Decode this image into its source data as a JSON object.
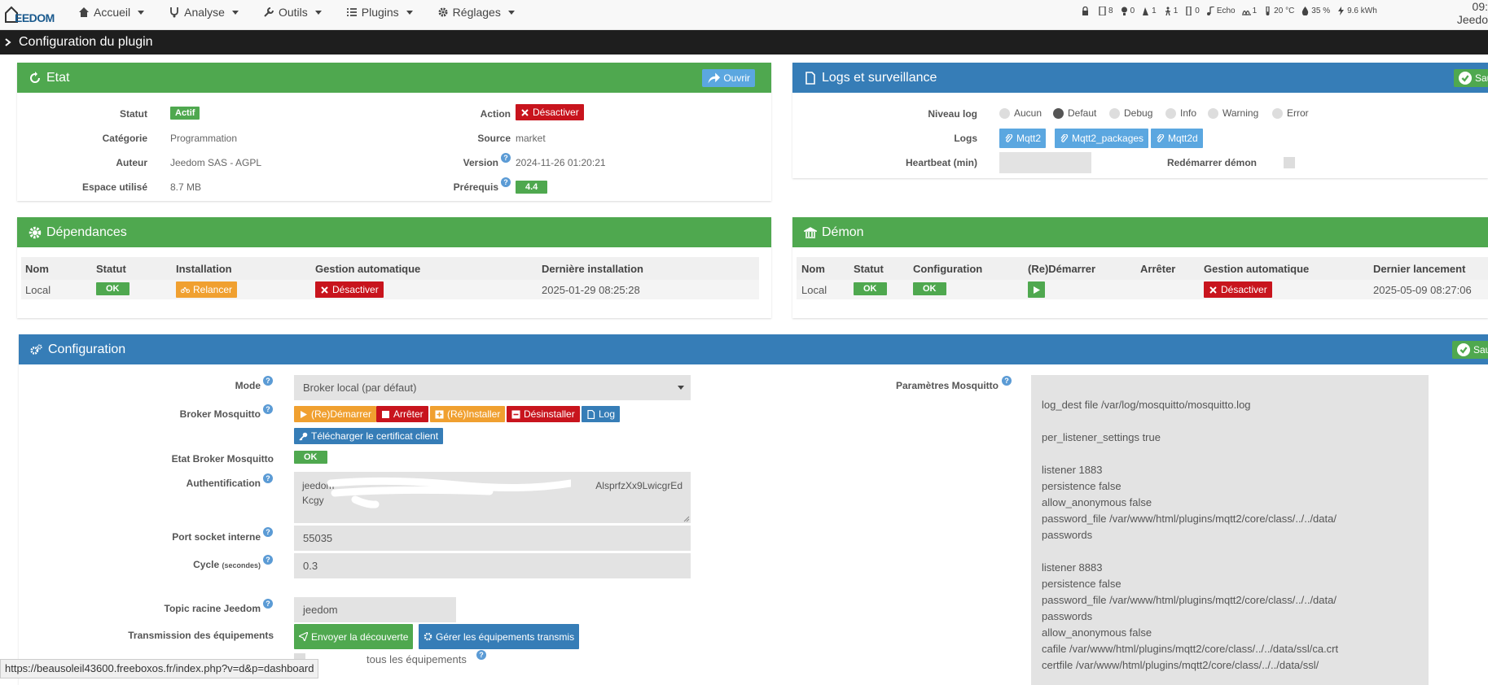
{
  "navbar": {
    "logo_text": "EEDOM",
    "menus": [
      "Accueil",
      "Analyse",
      "Outils",
      "Plugins",
      "Réglages"
    ],
    "summary": [
      {
        "icon": "lock-icon",
        "value": ""
      },
      {
        "icon": "door-icon",
        "value": "8"
      },
      {
        "icon": "light-icon",
        "value": "0"
      },
      {
        "icon": "motion-icon",
        "value": "1"
      },
      {
        "icon": "person-icon",
        "value": "1"
      },
      {
        "icon": "window-icon",
        "value": "0"
      },
      {
        "icon": "music-icon",
        "value": "Echo"
      },
      {
        "icon": "heater-icon",
        "value": "1"
      },
      {
        "icon": "thermometer-icon",
        "value": "20 °C"
      },
      {
        "icon": "humidity-icon",
        "value": "35 %"
      },
      {
        "icon": "power-icon",
        "value": "9.6 kWh"
      }
    ],
    "time": "09:",
    "user": "Jeedo"
  },
  "titlebar": {
    "title": "Configuration du plugin"
  },
  "etat": {
    "title": "Etat",
    "open_button": "Ouvrir",
    "statut_label": "Statut",
    "statut_value": "Actif",
    "action_label": "Action",
    "action_button": "Désactiver",
    "categorie_label": "Catégorie",
    "categorie_value": "Programmation",
    "source_label": "Source",
    "source_value": "market",
    "auteur_label": "Auteur",
    "auteur_value": "Jeedom SAS - AGPL",
    "version_label": "Version",
    "version_value": "2024-11-26 01:20:21",
    "espace_label": "Espace utilisé",
    "espace_value": "8.7 MB",
    "prerequis_label": "Prérequis",
    "prerequis_value": "4.4"
  },
  "logs": {
    "title": "Logs et surveillance",
    "save_button": "Sauv",
    "niveau_label": "Niveau log",
    "levels": [
      "Aucun",
      "Defaut",
      "Debug",
      "Info",
      "Warning",
      "Error"
    ],
    "selected_level": "Defaut",
    "logs_label": "Logs",
    "log_buttons": [
      "Mqtt2",
      "Mqtt2_packages",
      "Mqtt2d"
    ],
    "heartbeat_label": "Heartbeat (min)",
    "heartbeat_value": "",
    "restart_label": "Redémarrer démon"
  },
  "deps": {
    "title": "Dépendances",
    "headers": [
      "Nom",
      "Statut",
      "Installation",
      "Gestion automatique",
      "Dernière installation"
    ],
    "row": {
      "nom": "Local",
      "statut": "OK",
      "installation": "Relancer",
      "gestion": "Désactiver",
      "derniere": "2025-01-29 08:25:28"
    }
  },
  "demon": {
    "title": "Démon",
    "headers": [
      "Nom",
      "Statut",
      "Configuration",
      "(Re)Démarrer",
      "Arrêter",
      "Gestion automatique",
      "Dernier lancement"
    ],
    "row": {
      "nom": "Local",
      "statut": "OK",
      "configuration": "OK",
      "gestion": "Désactiver",
      "dernier": "2025-05-09 08:27:06"
    }
  },
  "config": {
    "title": "Configuration",
    "save_button": "Sauv",
    "mode_label": "Mode",
    "mode_value": "Broker local (par défaut)",
    "broker_label": "Broker Mosquitto",
    "broker_buttons": {
      "restart": "(Re)Démarrer",
      "stop": "Arrêter",
      "install": "(Ré)Installer",
      "uninstall": "Désinstaller",
      "log": "Log"
    },
    "cert_button": "Télécharger le certificat client",
    "etat_broker_label": "Etat Broker Mosquitto",
    "etat_broker_value": "OK",
    "auth_label": "Authentification",
    "auth_line1_start": "jeedom",
    "auth_line1_end": "AlsprfzXx9LwicgrEd",
    "auth_line2": "Kcgy",
    "port_label": "Port socket interne",
    "port_value": "55035",
    "cycle_label": "Cycle",
    "cycle_unit": "(secondes)",
    "cycle_value": "0.3",
    "topic_label": "Topic racine Jeedom",
    "topic_value": "jeedom",
    "transmission_label": "Transmission des équipements",
    "send_discovery_button": "Envoyer la découverte",
    "manage_button": "Gérer les équipements transmis",
    "transmit_all_label": "tous les équipements",
    "mosquitto_label": "Paramètres Mosquitto",
    "mosquitto_text": "log_dest file /var/log/mosquitto/mosquitto.log\n\nper_listener_settings true\n\nlistener 1883\npersistence false\nallow_anonymous false\npassword_file /var/www/html/plugins/mqtt2/core/class/../../data/\npasswords\n\nlistener 8883\npersistence false\npassword_file /var/www/html/plugins/mqtt2/core/class/../../data/\npasswords\nallow_anonymous false\ncafile /var/www/html/plugins/mqtt2/core/class/../../data/ssl/ca.crt\ncertfile /var/www/html/plugins/mqtt2/core/class/../../data/ssl/"
  },
  "status_url": "https://beausoleil43600.freeboxos.fr/index.php?v=d&p=dashboard",
  "colors": {
    "green": "#4fa84f",
    "blue": "#367db7",
    "red": "#c8141d",
    "orange": "#f0a030"
  }
}
